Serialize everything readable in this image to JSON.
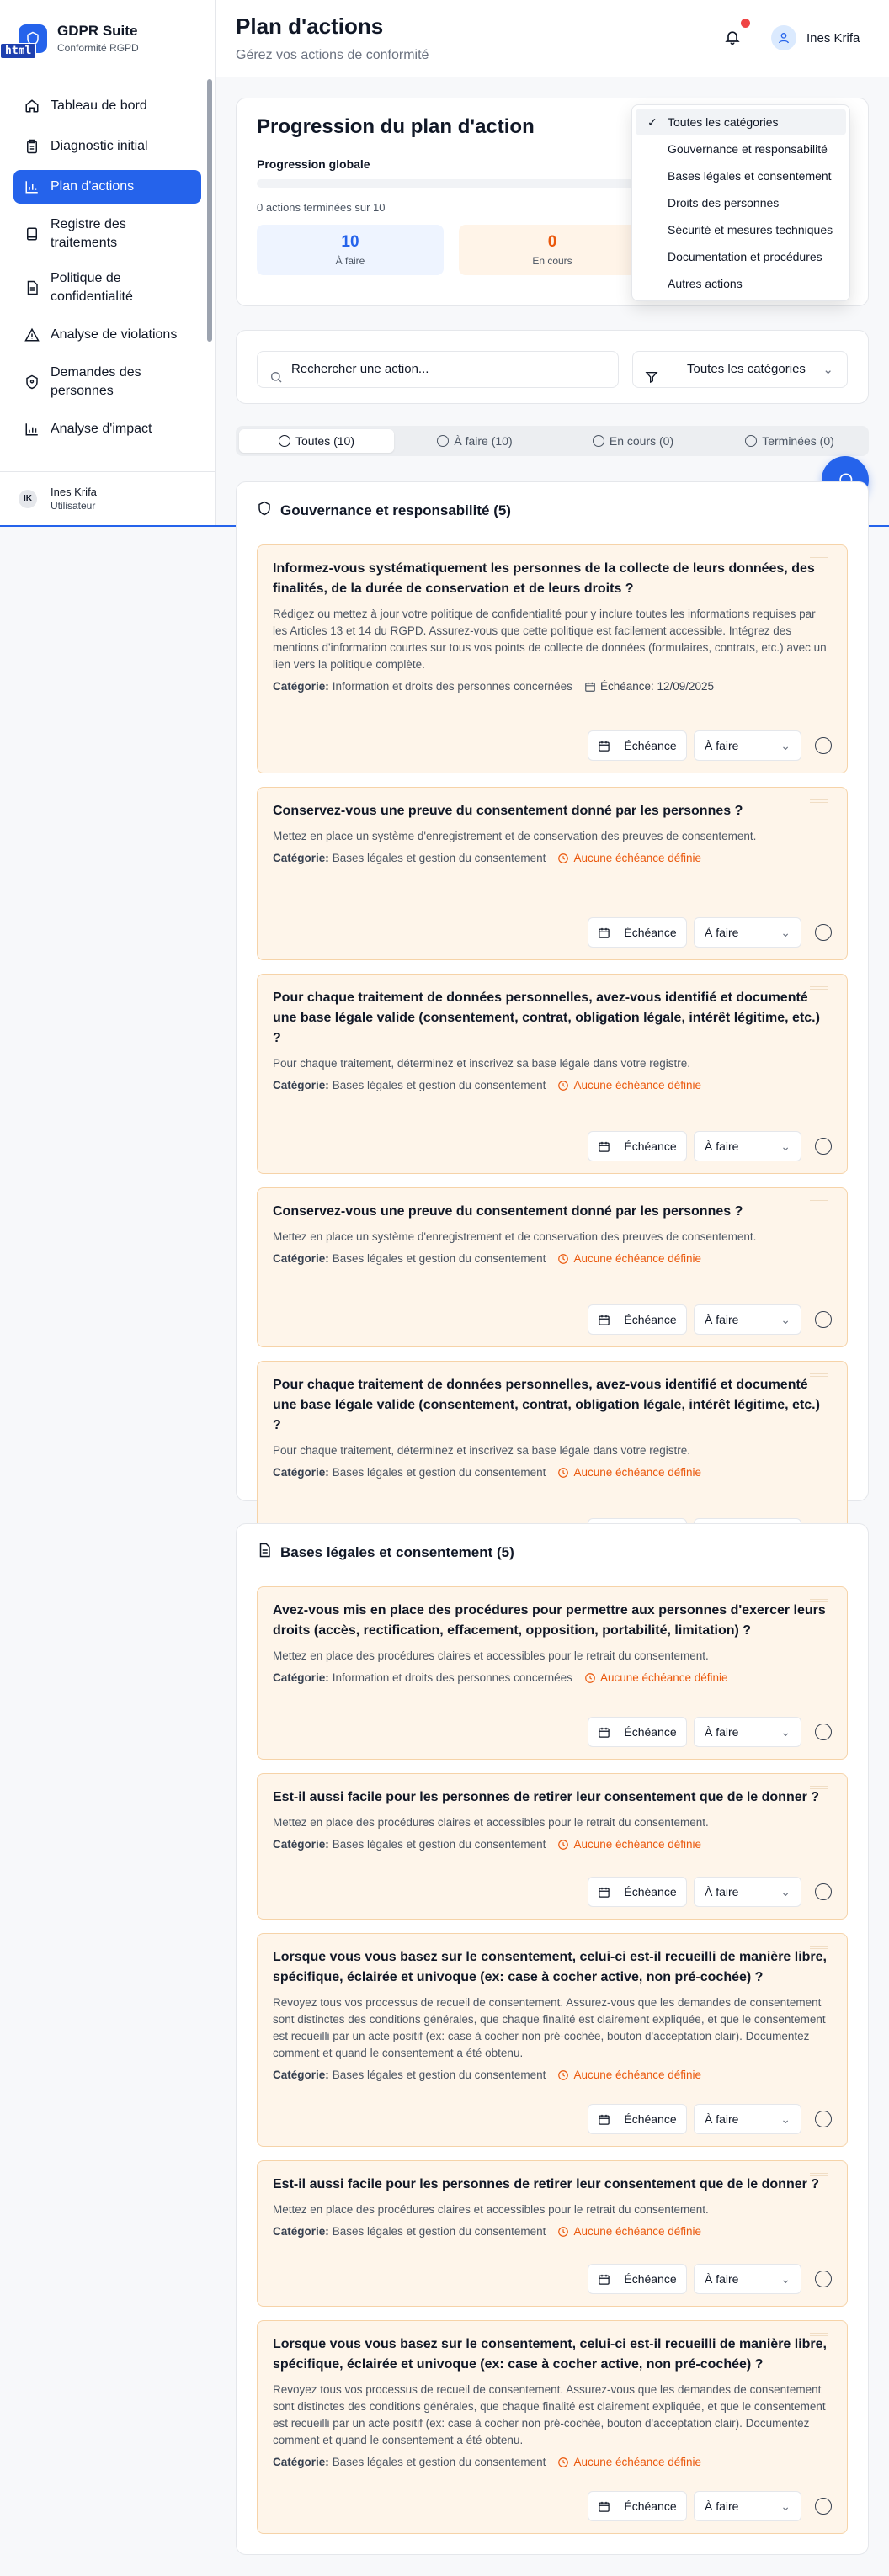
{
  "app": {
    "name": "GDPR Suite",
    "subtitle": "Conformité RGPD",
    "badge": "html"
  },
  "sidebar": {
    "items": [
      {
        "label": "Tableau de bord"
      },
      {
        "label": "Diagnostic initial"
      },
      {
        "label": "Plan d'actions"
      },
      {
        "label": "Registre des traitements"
      },
      {
        "label": "Politique de confidentialité"
      },
      {
        "label": "Analyse de violations"
      },
      {
        "label": "Demandes des personnes"
      },
      {
        "label": "Analyse d'impact"
      }
    ],
    "active_index": 2,
    "user": {
      "initials": "IK",
      "name": "Ines Krifa",
      "role": "Utilisateur"
    }
  },
  "header": {
    "title": "Plan d'actions",
    "subtitle": "Gérez vos actions de conformité",
    "user_name": "Ines Krifa"
  },
  "progress": {
    "title": "Progression du plan d'action",
    "label": "Progression globale",
    "percent": 0,
    "count_text": "0 actions terminées sur 10",
    "stats": [
      {
        "value": "10",
        "label": "À faire",
        "color": "#2563eb",
        "bg": "#eef4ff"
      },
      {
        "value": "0",
        "label": "En cours",
        "color": "#ea580c",
        "bg": "#fff4e8"
      }
    ]
  },
  "category_dropdown": {
    "options": [
      "Toutes les catégories",
      "Gouvernance et responsabilité",
      "Bases légales et consentement",
      "Droits des personnes",
      "Sécurité et mesures techniques",
      "Documentation et procédures",
      "Autres actions"
    ],
    "selected_index": 0
  },
  "filters": {
    "search_placeholder": "Rechercher une action...",
    "category_value": "Toutes les catégories"
  },
  "tabs": [
    {
      "label": "Toutes (10)"
    },
    {
      "label": "À faire (10)"
    },
    {
      "label": "En cours (0)"
    },
    {
      "label": "Terminées (0)"
    }
  ],
  "labels": {
    "category": "Catégorie:",
    "no_deadline": "Aucune échéance définie",
    "deadline_btn": "Échéance",
    "status": "À faire"
  },
  "sections": [
    {
      "title": "Gouvernance et responsabilité (5)",
      "items": [
        {
          "title": "Informez-vous systématiquement les personnes de la collecte de leurs données, des finalités, de la durée de conservation et de leurs droits ?",
          "desc": "Rédigez ou mettez à jour votre politique de confidentialité pour y inclure toutes les informations requises par les Articles 13 et 14 du RGPD. Assurez-vous que cette politique est facilement accessible. Intégrez des mentions d'information courtes sur tous vos points de collecte de données (formulaires, contrats, etc.) avec un lien vers la politique complète.",
          "category": "Information et droits des personnes concernées",
          "deadline": "Échéance: 12/09/2025"
        },
        {
          "title": "Conservez-vous une preuve du consentement donné par les personnes ?",
          "desc": "Mettez en place un système d'enregistrement et de conservation des preuves de consentement.",
          "category": "Bases légales et gestion du consentement",
          "deadline": ""
        },
        {
          "title": "Pour chaque traitement de données personnelles, avez-vous identifié et documenté une base légale valide (consentement, contrat, obligation légale, intérêt légitime, etc.) ?",
          "desc": "Pour chaque traitement, déterminez et inscrivez sa base légale dans votre registre.",
          "category": "Bases légales et gestion du consentement",
          "deadline": ""
        },
        {
          "title": "Conservez-vous une preuve du consentement donné par les personnes ?",
          "desc": "Mettez en place un système d'enregistrement et de conservation des preuves de consentement.",
          "category": "Bases légales et gestion du consentement",
          "deadline": ""
        },
        {
          "title": "Pour chaque traitement de données personnelles, avez-vous identifié et documenté une base légale valide (consentement, contrat, obligation légale, intérêt légitime, etc.) ?",
          "desc": "Pour chaque traitement, déterminez et inscrivez sa base légale dans votre registre.",
          "category": "Bases légales et gestion du consentement",
          "deadline": ""
        }
      ]
    },
    {
      "title": "Bases légales et consentement (5)",
      "items": [
        {
          "title": "Avez-vous mis en place des procédures pour permettre aux personnes d'exercer leurs droits (accès, rectification, effacement, opposition, portabilité, limitation) ?",
          "desc": "Mettez en place des procédures claires et accessibles pour le retrait du consentement.",
          "category": "Information et droits des personnes concernées",
          "deadline": ""
        },
        {
          "title": "Est-il aussi facile pour les personnes de retirer leur consentement que de le donner ?",
          "desc": "Mettez en place des procédures claires et accessibles pour le retrait du consentement.",
          "category": "Bases légales et gestion du consentement",
          "deadline": ""
        },
        {
          "title": "Lorsque vous vous basez sur le consentement, celui-ci est-il recueilli de manière libre, spécifique, éclairée et univoque (ex: case à cocher active, non pré-cochée) ?",
          "desc": "Revoyez tous vos processus de recueil de consentement. Assurez-vous que les demandes de consentement sont distinctes des conditions générales, que chaque finalité est clairement expliquée, et que le consentement est recueilli par un acte positif (ex: case à cocher non pré-cochée, bouton d'acceptation clair). Documentez comment et quand le consentement a été obtenu.",
          "category": "Bases légales et gestion du consentement",
          "deadline": ""
        },
        {
          "title": "Est-il aussi facile pour les personnes de retirer leur consentement que de le donner ?",
          "desc": "Mettez en place des procédures claires et accessibles pour le retrait du consentement.",
          "category": "Bases légales et gestion du consentement",
          "deadline": ""
        },
        {
          "title": "Lorsque vous vous basez sur le consentement, celui-ci est-il recueilli de manière libre, spécifique, éclairée et univoque (ex: case à cocher active, non pré-cochée) ?",
          "desc": "Revoyez tous vos processus de recueil de consentement. Assurez-vous que les demandes de consentement sont distinctes des conditions générales, que chaque finalité est clairement expliquée, et que le consentement est recueilli par un acte positif (ex: case à cocher non pré-cochée, bouton d'acceptation clair). Documentez comment et quand le consentement a été obtenu.",
          "category": "Bases légales et gestion du consentement",
          "deadline": ""
        }
      ]
    }
  ]
}
